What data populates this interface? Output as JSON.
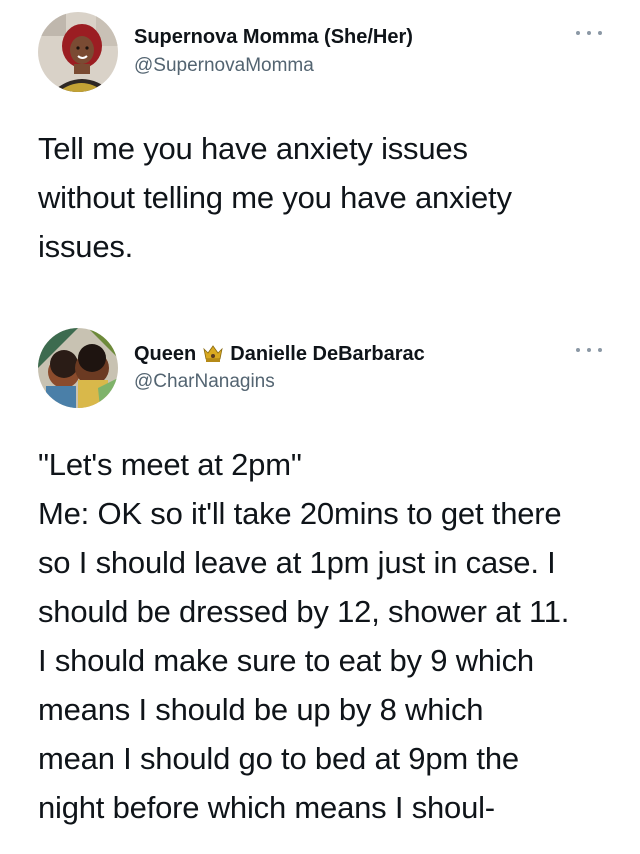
{
  "tweets": [
    {
      "display_name": "Supernova Momma (She/Her)",
      "handle": "@SupernovaMomma",
      "text_lines": [
        "Tell me you have anxiety issues",
        "without telling me you have anxiety",
        "issues."
      ]
    },
    {
      "display_name_part1": "Queen",
      "display_name_part2": "Danielle DeBarbarac",
      "handle": "@CharNanagins",
      "text_lines": [
        "\"Let's meet at 2pm\"",
        "Me: OK so it'll take 20mins to get there",
        "so I should leave at 1pm just in case. I",
        "should be dressed by 12, shower at 11.",
        "I should make sure to eat by 9 which",
        "means I should be up by 8 which",
        "mean I should go to bed at 9pm the",
        "night before which means I shoul-"
      ]
    }
  ]
}
